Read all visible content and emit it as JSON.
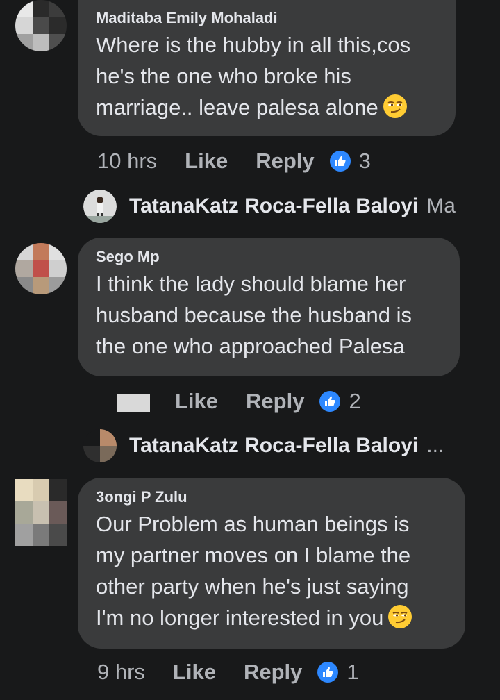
{
  "comments": [
    {
      "author": "Maditaba Emily Mohaladi",
      "lines": [
        "Where is the hubby in all this,cos",
        "he's the one who broke his",
        "marriage.. leave palesa alone"
      ],
      "time": "10 hrs",
      "like_label": "Like",
      "reply_label": "Reply",
      "reaction_count": "3",
      "emoji": "smirk-face-icon"
    },
    {
      "author": "Sego Mp",
      "lines": [
        "I think the lady should blame her",
        "husband because the husband is",
        "the one who approached Palesa"
      ],
      "time": "",
      "like_label": "Like",
      "reply_label": "Reply",
      "reaction_count": "2"
    },
    {
      "author": "3ongi P Zulu",
      "lines": [
        "Our Problem as human beings is",
        "my partner moves on I blame the",
        "other party when he's just saying",
        "I'm no longer interested in you"
      ],
      "time": "9 hrs",
      "like_label": "Like",
      "reply_label": "Reply",
      "reaction_count": "1",
      "emoji": "smirk-face-icon"
    }
  ],
  "replies": [
    {
      "name": "TatanaKatz Roca-Fella Baloyi",
      "snippet": "Ma"
    },
    {
      "name": "TatanaKatz Roca-Fella Baloyi",
      "snippet": "..."
    }
  ],
  "colors": {
    "background": "#18191a",
    "bubble": "#3a3b3c",
    "primary_text": "#e4e6eb",
    "secondary_text": "#b0b3b8",
    "like_blue": "#2d88ff"
  }
}
